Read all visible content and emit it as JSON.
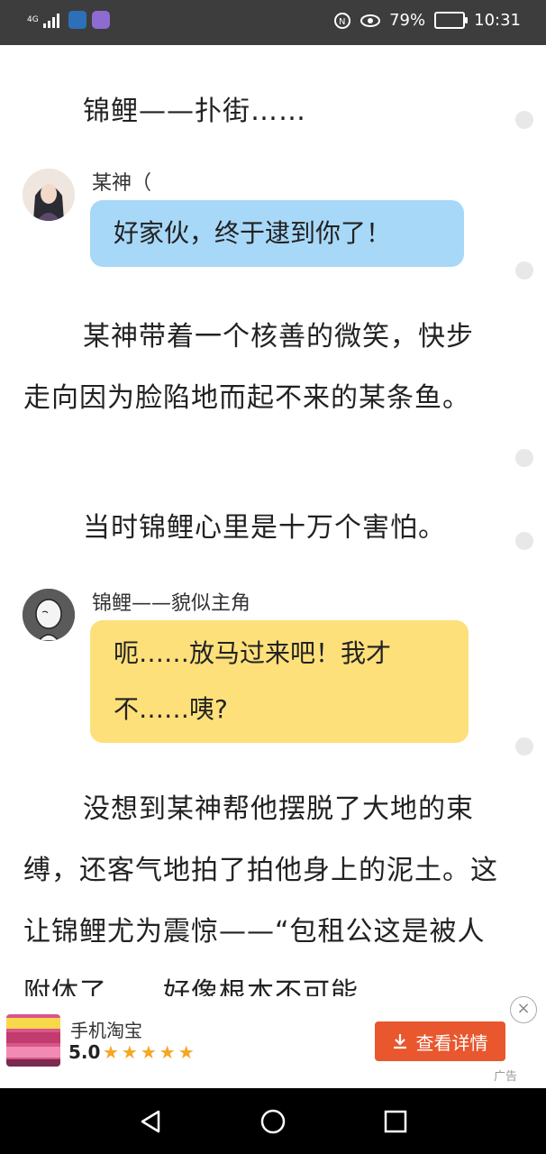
{
  "status_bar": {
    "network": "4G",
    "battery_percent": "79%",
    "time": "10:31"
  },
  "story": {
    "lines": [
      {
        "type": "para",
        "text": "锦鲤——扑街……"
      },
      {
        "type": "dialog",
        "speaker": "某神（",
        "text": "好家伙，终于逮到你了！",
        "bubble_color": "#a7d8f8",
        "avatar": "ancient-warrior-avatar"
      },
      {
        "type": "para",
        "text": "某神带着一个核善的微笑，快步走向因为脸陷地而起不来的某条鱼。"
      },
      {
        "type": "para",
        "text": "当时锦鲤心里是十万个害怕。"
      },
      {
        "type": "dialog",
        "speaker": "锦鲤——貌似主角",
        "text": "呃……放马过来吧！我才不……咦?",
        "bubble_color": "#fde07a",
        "avatar": "sketch-character-avatar"
      },
      {
        "type": "para",
        "text": "没想到某神帮他摆脱了大地的束缚，还客气地拍了拍他身上的泥土。这让锦鲤尤为震惊——“包租公这是被人附体了……好像根本不可能……"
      }
    ]
  },
  "ad": {
    "app_name": "手机淘宝",
    "rating": "5.0",
    "stars": "★★★★★",
    "button_label": "查看详情",
    "label": "广告",
    "close_symbol": "×"
  },
  "colors": {
    "status_bg": "#3d3d3d",
    "blue_bubble": "#a7d8f8",
    "yellow_bubble": "#fde07a",
    "ad_button": "#e8572e"
  }
}
